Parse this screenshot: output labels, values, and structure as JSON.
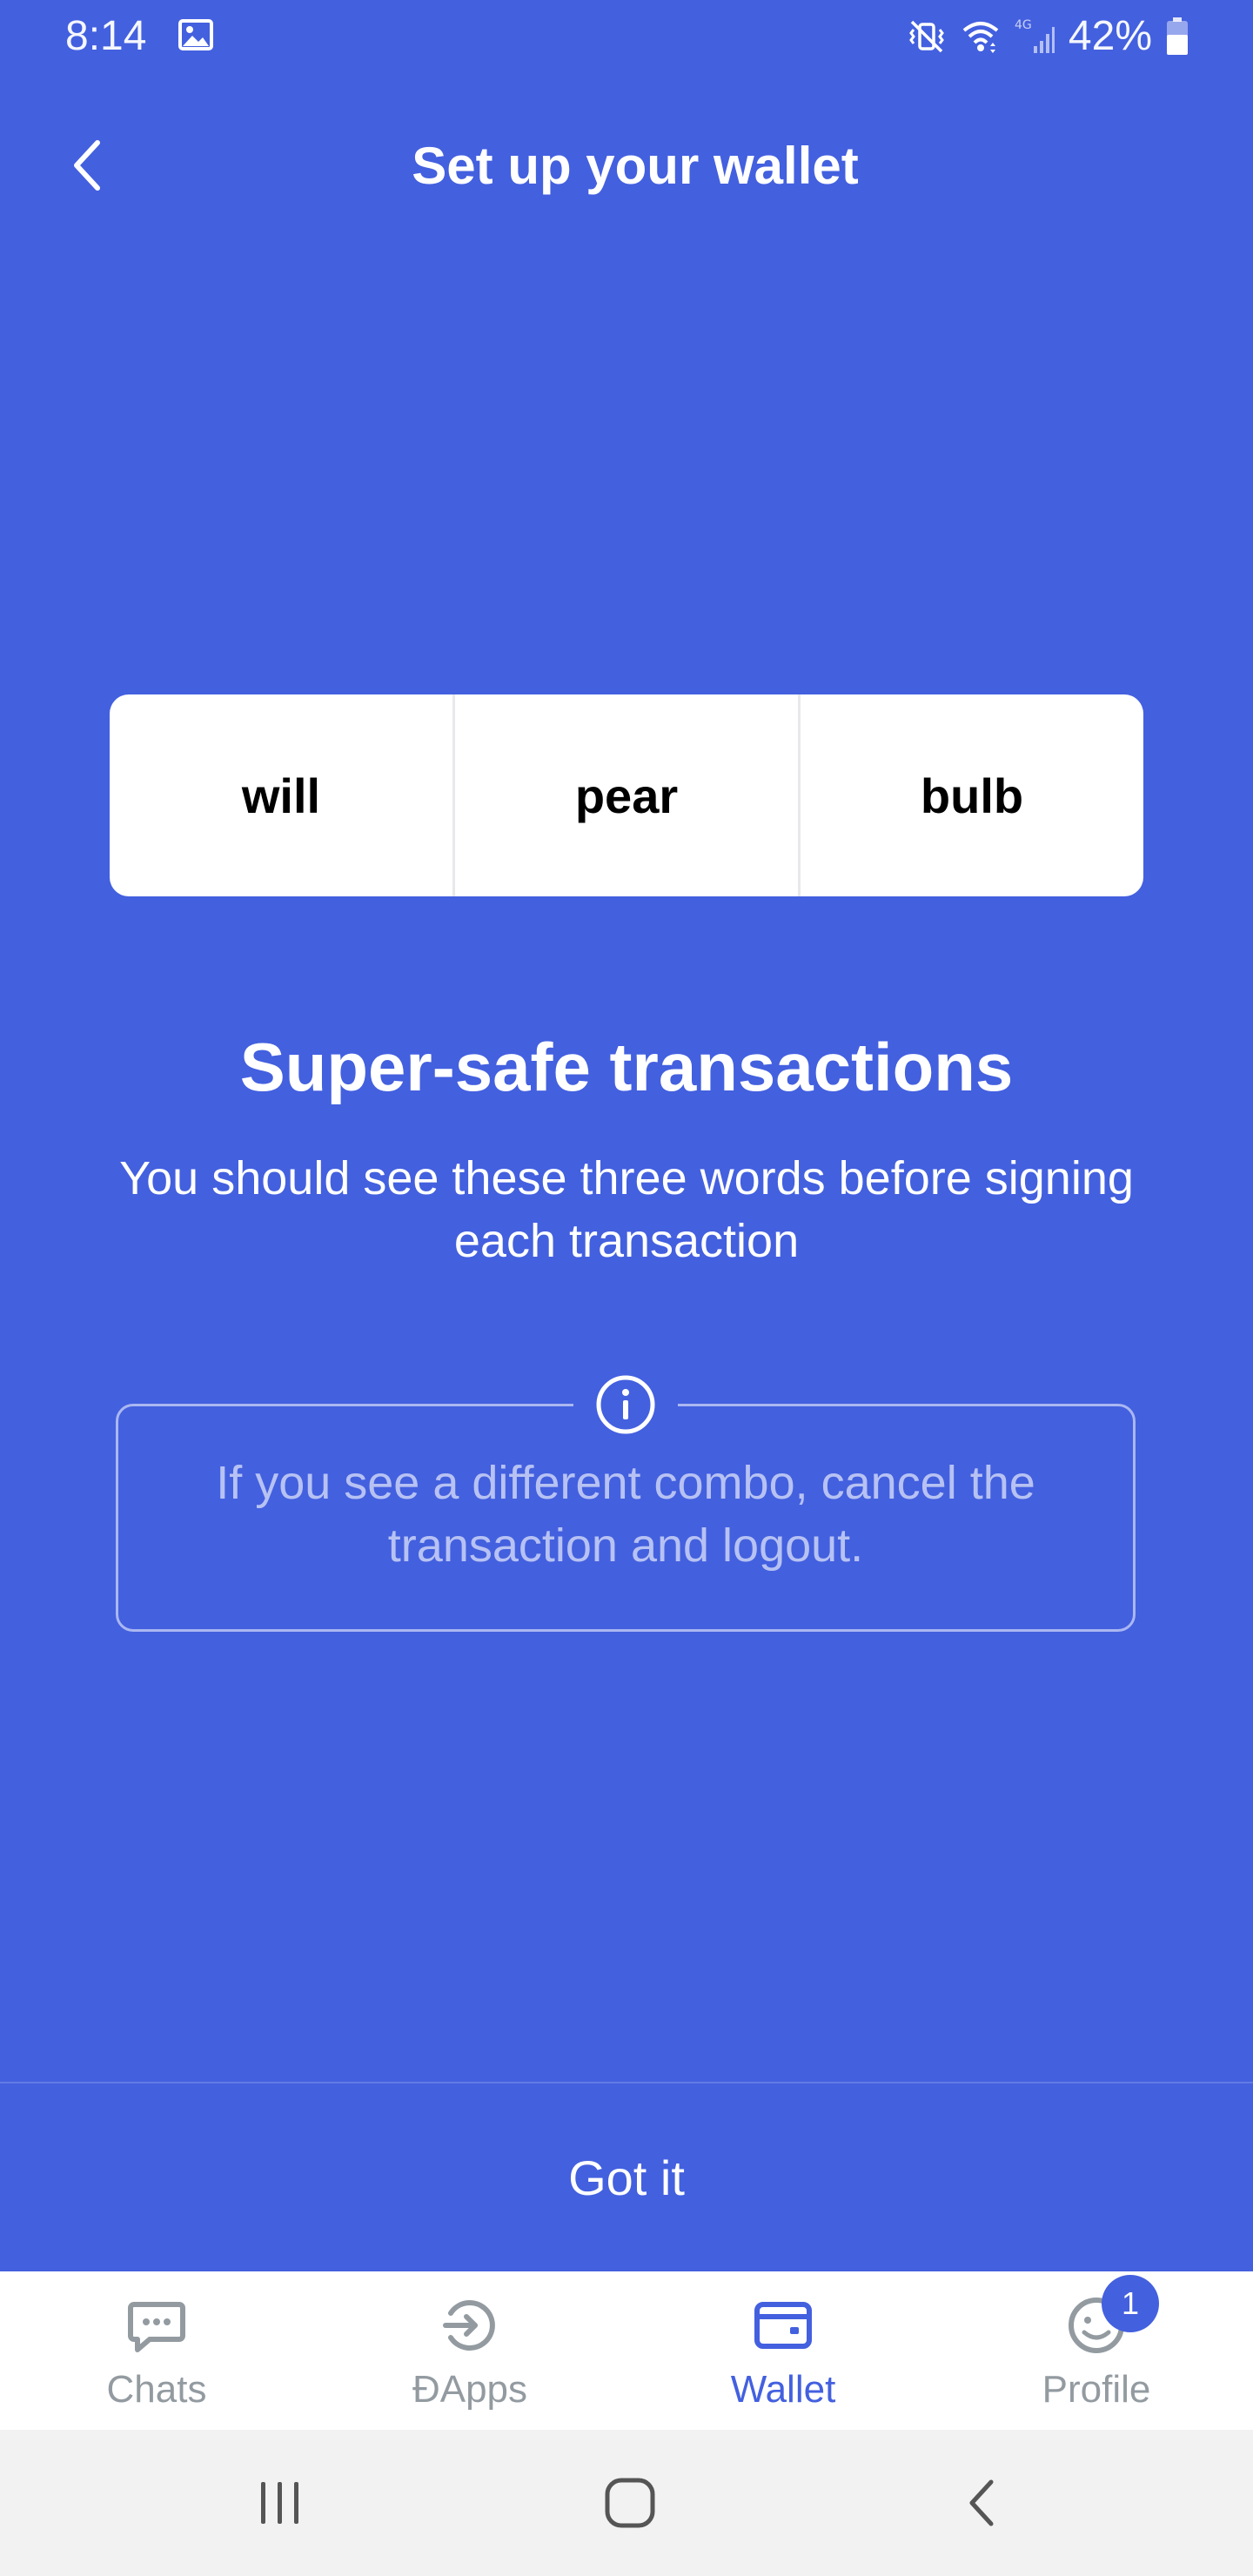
{
  "status_bar": {
    "time": "8:14",
    "battery_percent": "42%",
    "network": "4G"
  },
  "header": {
    "title": "Set up your wallet",
    "back_icon": "chevron-left-icon"
  },
  "words": [
    "will",
    "pear",
    "bulb"
  ],
  "headline": "Super-safe transactions",
  "subtext": "You should see these three words before signing each transaction",
  "info": {
    "icon": "info-icon",
    "text": "If you see a different combo, cancel the transaction and logout."
  },
  "action": {
    "got_it_label": "Got it"
  },
  "bottom_nav": {
    "tabs": [
      {
        "label": "Chats",
        "icon": "chat-bubble-icon",
        "active": false
      },
      {
        "label": "ÐApps",
        "icon": "dapps-icon",
        "active": false
      },
      {
        "label": "Wallet",
        "icon": "wallet-icon",
        "active": true
      },
      {
        "label": "Profile",
        "icon": "profile-icon",
        "active": false,
        "badge": "1"
      }
    ]
  },
  "colors": {
    "accent": "#4360DF",
    "nav_inactive": "#939BA1",
    "card_bg": "#FFFFFF",
    "system_nav_bg": "#F2F2F2"
  }
}
